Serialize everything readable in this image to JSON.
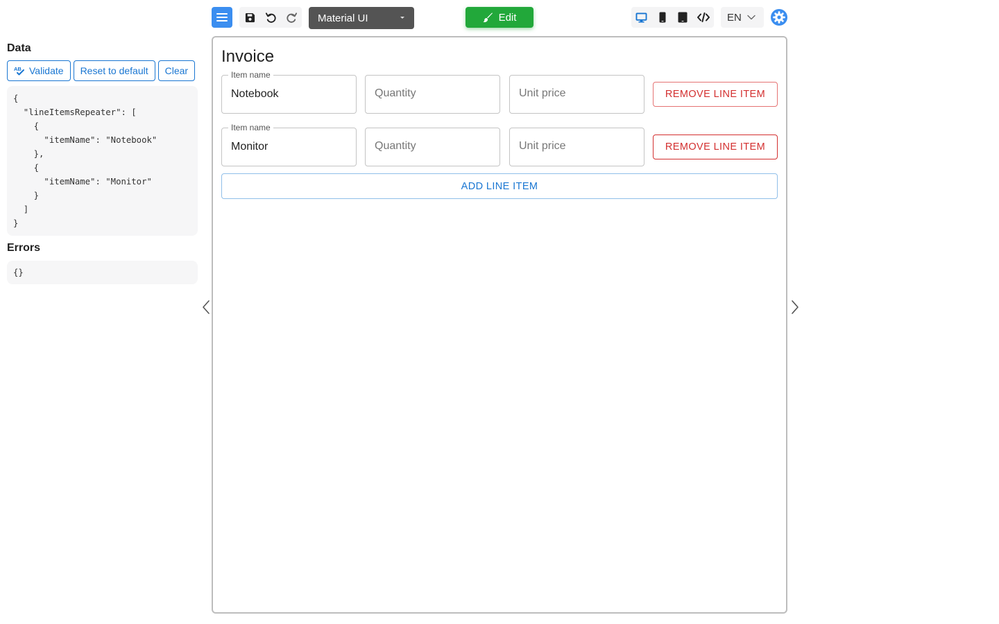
{
  "toolbar": {
    "theme_select": "Material UI",
    "edit_label": "Edit",
    "language": "EN"
  },
  "data_panel": {
    "heading": "Data",
    "validate_label": "Validate",
    "reset_label": "Reset to default",
    "clear_label": "Clear",
    "json_text": "{\n  \"lineItemsRepeater\": [\n    {\n      \"itemName\": \"Notebook\"\n    },\n    {\n      \"itemName\": \"Monitor\"\n    }\n  ]\n}",
    "errors_heading": "Errors",
    "errors_text": "{}"
  },
  "form": {
    "title": "Invoice",
    "line_items": [
      {
        "name_label": "Item name",
        "name_value": "Notebook",
        "quantity_placeholder": "Quantity",
        "unit_price_placeholder": "Unit price",
        "remove_label": "REMOVE LINE ITEM"
      },
      {
        "name_label": "Item name",
        "name_value": "Monitor",
        "quantity_placeholder": "Quantity",
        "unit_price_placeholder": "Unit price",
        "remove_label": "REMOVE LINE ITEM"
      }
    ],
    "add_label": "ADD LINE ITEM"
  },
  "icons": {
    "menu": "hamburger-icon",
    "save": "floppy-disk-icon",
    "undo": "undo-icon",
    "redo": "redo-icon",
    "edit": "paintbrush-icon",
    "desktop": "desktop-icon",
    "mobile": "mobile-icon",
    "tablet": "tablet-icon",
    "code": "code-icon",
    "language_caret": "chevron-down-icon",
    "settings": "gear-icon",
    "validate": "spellcheck-icon",
    "prev": "chevron-left-icon",
    "next": "chevron-right-icon"
  },
  "colors": {
    "primary": "#1976d2",
    "menu_button": "#3b8ef0",
    "edit_button": "#22a83a",
    "theme_select": "#545454",
    "danger": "#d32f2f"
  }
}
